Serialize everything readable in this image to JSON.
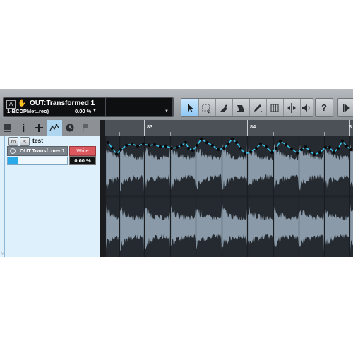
{
  "toolbar": {
    "info_btn_a": "A",
    "title": "OUT:Transformed 1",
    "subtitle": "1-BCDPMet..reo)",
    "percent": "0.00 %",
    "tools": [
      "arrow-tool",
      "range-tool",
      "eraser-tool",
      "paint-tool",
      "draw-tool",
      "quantize-tool",
      "split-tool",
      "listen-tool",
      "help-button",
      "play-button"
    ]
  },
  "side_tabs": [
    "list-icon",
    "info-icon",
    "add-icon",
    "automation-icon",
    "clock-icon",
    "flag-icon"
  ],
  "track": {
    "mute": "m",
    "solo": "s",
    "name": "test",
    "param": "OUT:Transf..med1",
    "write_label": "Write",
    "value": "0.00 %",
    "slider_fraction": 0.18
  },
  "ruler": {
    "bars": [
      "83",
      "84",
      "8"
    ]
  },
  "colors": {
    "automation": "#39c6ee",
    "waveform": "#8a9aa8",
    "active_tool": "#9bd1fa",
    "write": "#d9575d"
  }
}
